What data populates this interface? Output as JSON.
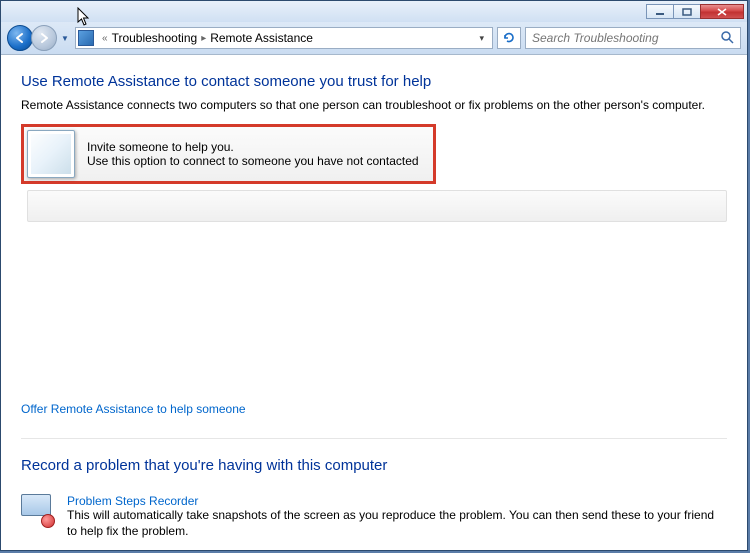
{
  "window": {
    "minimize_tip": "Minimize",
    "maximize_tip": "Maximize",
    "close_tip": "Close"
  },
  "nav": {
    "back_tip": "Back",
    "forward_tip": "Forward",
    "recent_tip": "Recent pages"
  },
  "breadcrumb": {
    "prefix": "«",
    "seg1": "Troubleshooting",
    "seg2": "Remote Assistance"
  },
  "toolbar": {
    "refresh_tip": "Refresh"
  },
  "search": {
    "placeholder": "Search Troubleshooting"
  },
  "main": {
    "heading": "Use Remote Assistance to contact someone you trust for help",
    "description": "Remote Assistance connects two computers so that one person can troubleshoot or fix problems on the other person's computer.",
    "invite": {
      "title": "Invite someone to help you.",
      "desc": "Use this option to connect to someone you have not contacted"
    },
    "offer_link": "Offer Remote Assistance to help someone",
    "record_heading": "Record a problem that you're having with this computer",
    "psr": {
      "title": "Problem Steps Recorder",
      "desc": "This will automatically take snapshots of the screen as you reproduce the problem. You can then send these to your friend to help fix the problem."
    }
  }
}
